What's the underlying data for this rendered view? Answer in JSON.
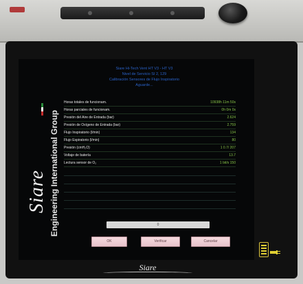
{
  "device": {
    "brand": "Siare",
    "brand_subtitle": "Engineering International Group",
    "bottom_logo": "Siare"
  },
  "screen": {
    "header": [
      "Siare Hi-Tech Vent HT V3 - HT V3",
      "Nivel de Servicio SI 2, 129",
      "Calibración Sensores de Flujo Inspiratorio",
      "Aguarde..."
    ],
    "rows": [
      {
        "label": "Horas totales de funcionam.",
        "value": "10938h 11m 50s"
      },
      {
        "label": "Horas parciales de funcionam.",
        "value": "0h 0m 0s"
      },
      {
        "label": "Presión del Aire de Entrada (bar)",
        "value": "2.624"
      },
      {
        "label": "Presión de Oxígeno de Entrada (bar)",
        "value": "2.759"
      },
      {
        "label": "Flujo Inspiratorio (l/min)",
        "value": "134"
      },
      {
        "label": "Flujo Espiratorio (l/min)",
        "value": "80"
      },
      {
        "label": "Presión (cmH₂O)",
        "value": "1 0.7/ 207"
      },
      {
        "label": "Voltaje de batería",
        "value": "13.7"
      },
      {
        "label": "Lectura sensor de O₂",
        "value": "1 bit/s 150"
      }
    ],
    "input_value": "0",
    "buttons": {
      "ok": "OK",
      "verify": "Verificar",
      "cancel": "Cancelar"
    }
  },
  "colors": {
    "header_text": "#2a62c8",
    "value_text": "#86c247",
    "button_bg": "#f0d2d8",
    "battery": "#e0cf33"
  }
}
